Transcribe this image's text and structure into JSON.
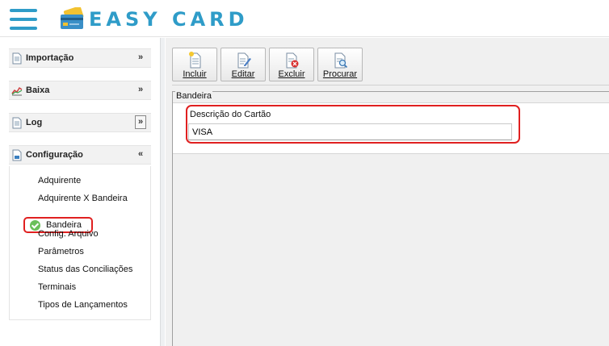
{
  "app": {
    "title": "EASY CARD",
    "brand_color": "#2f9cc8"
  },
  "sidebar": {
    "panels": [
      {
        "label": "Importação",
        "icon": "document-icon",
        "expanded": false
      },
      {
        "label": "Baixa",
        "icon": "chart-icon",
        "expanded": false
      },
      {
        "label": "Log",
        "icon": "document-icon",
        "expanded": false
      },
      {
        "label": "Configuração",
        "icon": "config-icon",
        "expanded": true
      }
    ],
    "config_items": [
      {
        "label": "Adquirente"
      },
      {
        "label": "Adquirente X Bandeira"
      },
      {
        "label": "Bandeira",
        "active": true
      },
      {
        "label": "Config. Arquivo"
      },
      {
        "label": "Parâmetros"
      },
      {
        "label": "Status das Conciliações"
      },
      {
        "label": "Terminais"
      },
      {
        "label": "Tipos de Lançamentos"
      }
    ]
  },
  "toolbar": {
    "buttons": [
      {
        "label": "Incluir",
        "icon": "new-document-icon"
      },
      {
        "label": "Editar",
        "icon": "edit-document-icon"
      },
      {
        "label": "Excluir",
        "icon": "delete-document-icon"
      },
      {
        "label": "Procurar",
        "icon": "search-document-icon"
      }
    ]
  },
  "form": {
    "group_title": "Bandeira",
    "description_label": "Descrição do Cartão",
    "description_value": "VISA"
  },
  "colors": {
    "highlight": "#e02020",
    "check": "#6abf5a"
  }
}
